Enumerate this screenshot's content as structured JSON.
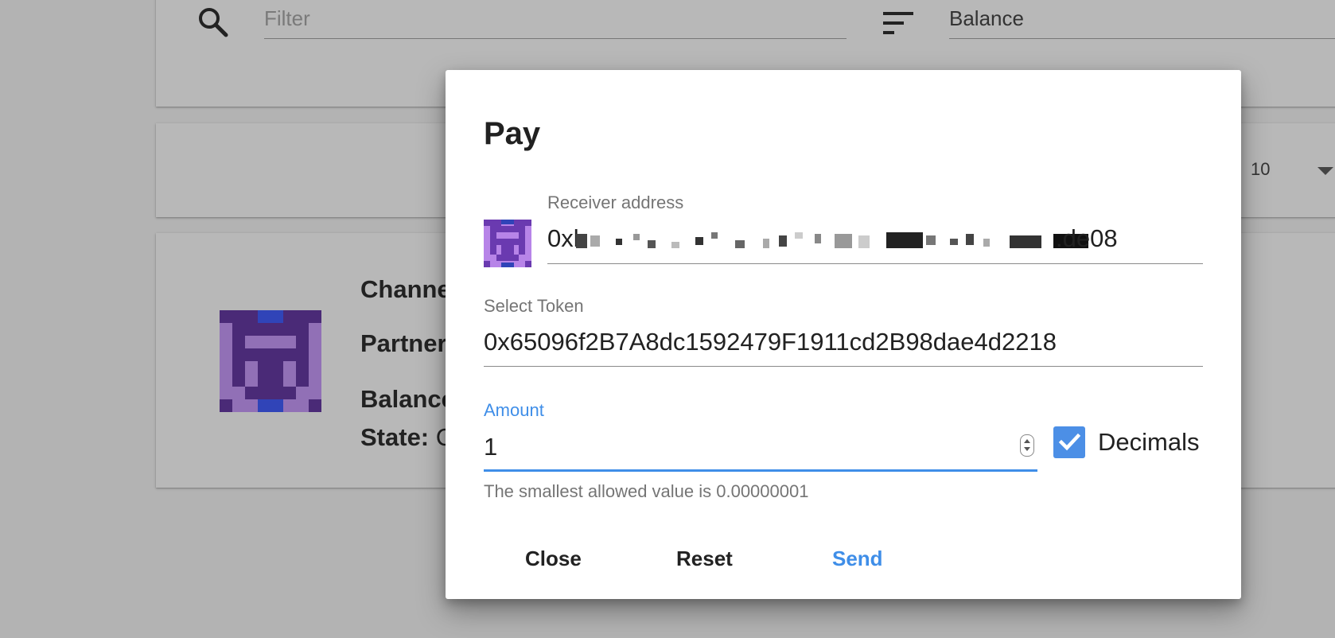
{
  "background": {
    "filter": {
      "placeholder": "Filter",
      "sort_value": "Balance"
    },
    "pager": {
      "page_size": "10"
    },
    "channel": {
      "labels": [
        "Channe",
        "Partner",
        "Balance",
        "State:"
      ],
      "state_value_partial": "C"
    }
  },
  "dialog": {
    "title": "Pay",
    "receiver": {
      "label": "Receiver address",
      "value_prefix": "0xl",
      "value_suffix": ".de08"
    },
    "token": {
      "label": "Select Token",
      "value": "0x65096f2B7A8dc1592479F1911cd2B98dae4d2218"
    },
    "amount": {
      "label": "Amount",
      "value": "1",
      "hint": "The smallest allowed value is 0.00000001"
    },
    "decimals": {
      "label": "Decimals",
      "checked": true
    },
    "buttons": {
      "close": "Close",
      "reset": "Reset",
      "send": "Send"
    }
  },
  "colors": {
    "accent": "#3f8ee8",
    "overlay_bg": "#b3b3b3",
    "identicon_light": "#b784e8",
    "identicon_dark": "#5a2d91",
    "identicon_blue": "#3044b8"
  }
}
